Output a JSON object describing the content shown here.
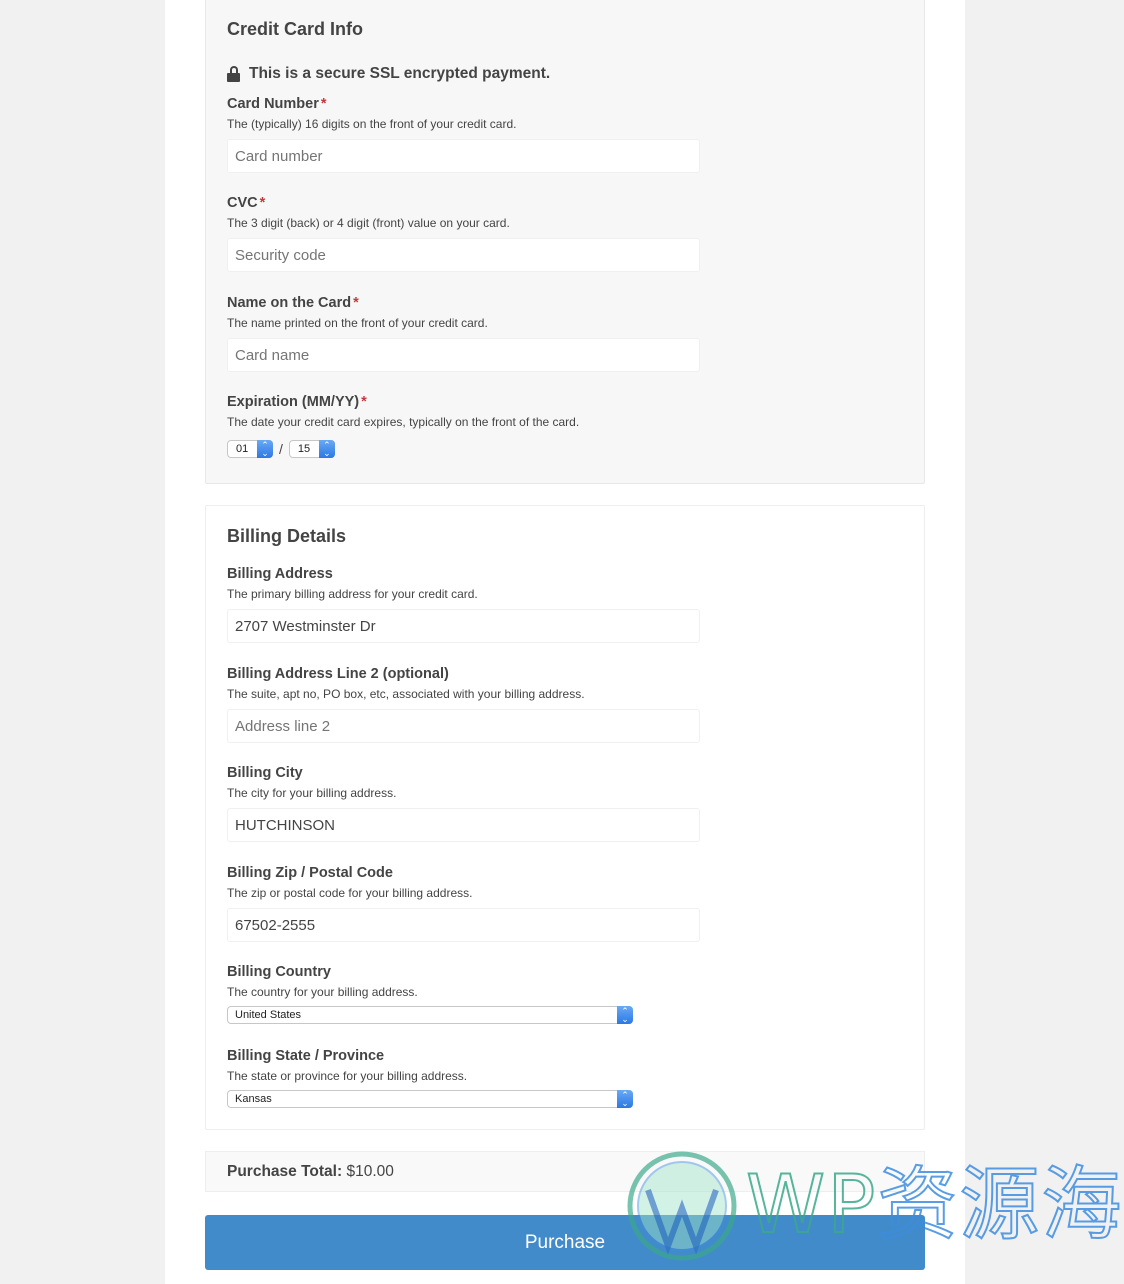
{
  "credit_card": {
    "title": "Credit Card Info",
    "secure_notice": "This is a secure SSL encrypted payment.",
    "required_mark": "*",
    "fields": [
      {
        "label": "Card Number",
        "required": true,
        "description": "The (typically) 16 digits on the front of your credit card.",
        "value": "",
        "placeholder": "Card number"
      },
      {
        "label": "CVC",
        "required": true,
        "description": "The 3 digit (back) or 4 digit (front) value on your card.",
        "value": "",
        "placeholder": "Security code"
      },
      {
        "label": "Name on the Card",
        "required": true,
        "description": "The name printed on the front of your credit card.",
        "value": "",
        "placeholder": "Card name"
      }
    ],
    "expiration": {
      "label": "Expiration (MM/YY)",
      "required": true,
      "description": "The date your credit card expires, typically on the front of the card.",
      "month": "01",
      "separator": "/",
      "year": "15"
    }
  },
  "billing": {
    "title": "Billing Details",
    "fields": [
      {
        "label": "Billing Address",
        "description": "The primary billing address for your credit card.",
        "value": "2707 Westminster Dr",
        "placeholder": ""
      },
      {
        "label": "Billing Address Line 2 (optional)",
        "description": "The suite, apt no, PO box, etc, associated with your billing address.",
        "value": "",
        "placeholder": "Address line 2"
      },
      {
        "label": "Billing City",
        "description": "The city for your billing address.",
        "value": "HUTCHINSON",
        "placeholder": ""
      },
      {
        "label": "Billing Zip / Postal Code",
        "description": "The zip or postal code for your billing address.",
        "value": "67502-2555",
        "placeholder": ""
      }
    ],
    "country": {
      "label": "Billing Country",
      "description": "The country for your billing address.",
      "selected": "United States"
    },
    "state": {
      "label": "Billing State / Province",
      "description": "The state or province for your billing address.",
      "selected": "Kansas"
    }
  },
  "summary": {
    "total_label": "Purchase Total:",
    "total_value": "$10.00"
  },
  "actions": {
    "purchase_label": "Purchase",
    "purchase_color": "#428bca"
  },
  "watermark": {
    "brand": "WP",
    "text": "资源海"
  }
}
